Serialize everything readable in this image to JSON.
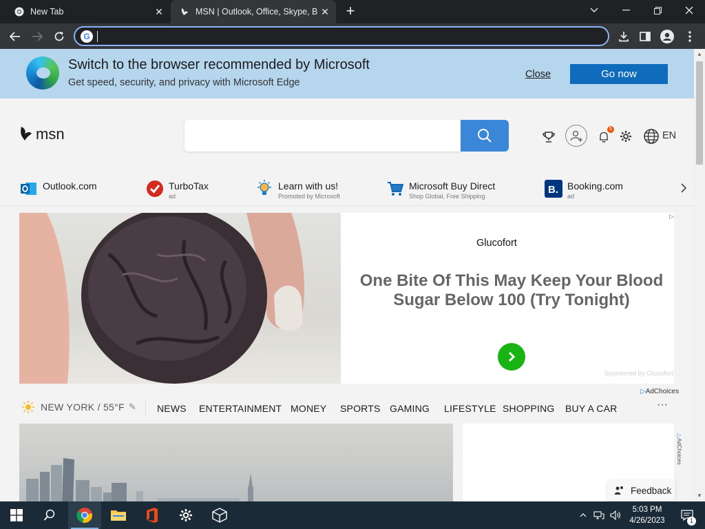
{
  "browser": {
    "tabs": [
      {
        "title": "New Tab",
        "active": false
      },
      {
        "title": "MSN | Outlook, Office, Skype, Bing, Breaking News, and Latest Videos",
        "active": true
      }
    ],
    "address": {
      "value": "",
      "placeholder": ""
    }
  },
  "edge_banner": {
    "title": "Switch to the browser recommended by Microsoft",
    "subtitle": "Get speed, security, and privacy with Microsoft Edge",
    "close_label": "Close",
    "go_label": "Go now"
  },
  "header": {
    "logo_text": "msn",
    "search_placeholder": "",
    "notification_count": "5",
    "language": "EN"
  },
  "quicklinks": [
    {
      "name": "Outlook.com",
      "sub": ""
    },
    {
      "name": "TurboTax",
      "sub": "ad"
    },
    {
      "name": "Learn with us!",
      "sub": "Promoted by Microsoft"
    },
    {
      "name": "Microsoft Buy Direct",
      "sub": "Shop Global, Free Shipping"
    },
    {
      "name": "Booking.com",
      "sub": "ad"
    }
  ],
  "ad": {
    "brand": "Glucofort",
    "headline": "One Bite Of This May Keep Your Blood Sugar Below 100 (Try Tonight)",
    "sponsored": "Sponsored by Glucofort",
    "adchoices": "AdChoices"
  },
  "nav": {
    "weather": "NEW YORK / 55°F",
    "items": [
      "NEWS",
      "ENTERTAINMENT",
      "MONEY",
      "SPORTS",
      "GAMING",
      "LIFESTYLE",
      "SHOPPING",
      "BUY A CAR"
    ],
    "more": "···"
  },
  "side_ad": {
    "adchoices": "AdChoices"
  },
  "feedback": {
    "label": "Feedback"
  },
  "taskbar": {
    "time": "5:03 PM",
    "date": "4/26/2023",
    "notification_count": "1"
  },
  "colors": {
    "accent": "#3a86d9",
    "edge_banner_bg": "#b6d6ee",
    "go_button": "#0f6cbd",
    "ad_arrow": "#18b414",
    "chrome_dark": "#202124",
    "taskbar": "#1a2a36"
  }
}
